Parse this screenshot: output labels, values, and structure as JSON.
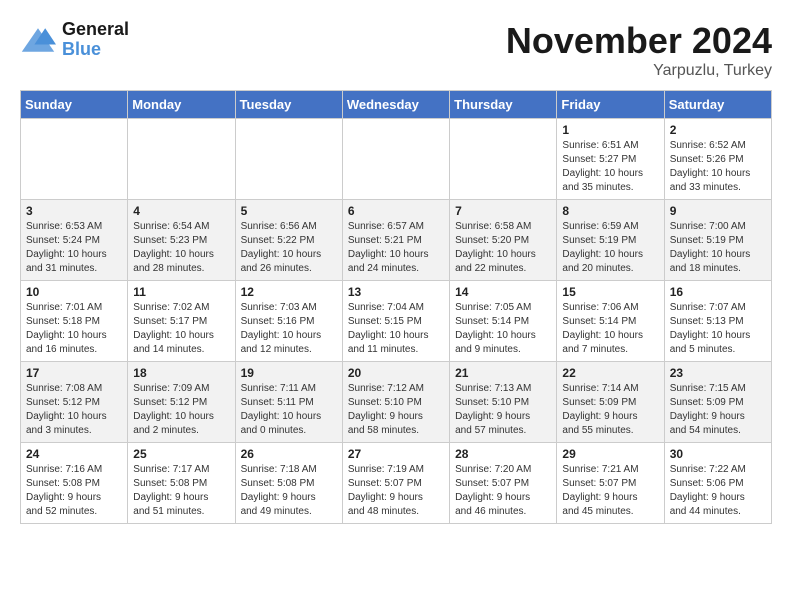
{
  "header": {
    "logo_line1": "General",
    "logo_line2": "Blue",
    "month": "November 2024",
    "location": "Yarpuzlu, Turkey"
  },
  "weekdays": [
    "Sunday",
    "Monday",
    "Tuesday",
    "Wednesday",
    "Thursday",
    "Friday",
    "Saturday"
  ],
  "weeks": [
    [
      {
        "day": "",
        "info": ""
      },
      {
        "day": "",
        "info": ""
      },
      {
        "day": "",
        "info": ""
      },
      {
        "day": "",
        "info": ""
      },
      {
        "day": "",
        "info": ""
      },
      {
        "day": "1",
        "info": "Sunrise: 6:51 AM\nSunset: 5:27 PM\nDaylight: 10 hours\nand 35 minutes."
      },
      {
        "day": "2",
        "info": "Sunrise: 6:52 AM\nSunset: 5:26 PM\nDaylight: 10 hours\nand 33 minutes."
      }
    ],
    [
      {
        "day": "3",
        "info": "Sunrise: 6:53 AM\nSunset: 5:24 PM\nDaylight: 10 hours\nand 31 minutes."
      },
      {
        "day": "4",
        "info": "Sunrise: 6:54 AM\nSunset: 5:23 PM\nDaylight: 10 hours\nand 28 minutes."
      },
      {
        "day": "5",
        "info": "Sunrise: 6:56 AM\nSunset: 5:22 PM\nDaylight: 10 hours\nand 26 minutes."
      },
      {
        "day": "6",
        "info": "Sunrise: 6:57 AM\nSunset: 5:21 PM\nDaylight: 10 hours\nand 24 minutes."
      },
      {
        "day": "7",
        "info": "Sunrise: 6:58 AM\nSunset: 5:20 PM\nDaylight: 10 hours\nand 22 minutes."
      },
      {
        "day": "8",
        "info": "Sunrise: 6:59 AM\nSunset: 5:19 PM\nDaylight: 10 hours\nand 20 minutes."
      },
      {
        "day": "9",
        "info": "Sunrise: 7:00 AM\nSunset: 5:19 PM\nDaylight: 10 hours\nand 18 minutes."
      }
    ],
    [
      {
        "day": "10",
        "info": "Sunrise: 7:01 AM\nSunset: 5:18 PM\nDaylight: 10 hours\nand 16 minutes."
      },
      {
        "day": "11",
        "info": "Sunrise: 7:02 AM\nSunset: 5:17 PM\nDaylight: 10 hours\nand 14 minutes."
      },
      {
        "day": "12",
        "info": "Sunrise: 7:03 AM\nSunset: 5:16 PM\nDaylight: 10 hours\nand 12 minutes."
      },
      {
        "day": "13",
        "info": "Sunrise: 7:04 AM\nSunset: 5:15 PM\nDaylight: 10 hours\nand 11 minutes."
      },
      {
        "day": "14",
        "info": "Sunrise: 7:05 AM\nSunset: 5:14 PM\nDaylight: 10 hours\nand 9 minutes."
      },
      {
        "day": "15",
        "info": "Sunrise: 7:06 AM\nSunset: 5:14 PM\nDaylight: 10 hours\nand 7 minutes."
      },
      {
        "day": "16",
        "info": "Sunrise: 7:07 AM\nSunset: 5:13 PM\nDaylight: 10 hours\nand 5 minutes."
      }
    ],
    [
      {
        "day": "17",
        "info": "Sunrise: 7:08 AM\nSunset: 5:12 PM\nDaylight: 10 hours\nand 3 minutes."
      },
      {
        "day": "18",
        "info": "Sunrise: 7:09 AM\nSunset: 5:12 PM\nDaylight: 10 hours\nand 2 minutes."
      },
      {
        "day": "19",
        "info": "Sunrise: 7:11 AM\nSunset: 5:11 PM\nDaylight: 10 hours\nand 0 minutes."
      },
      {
        "day": "20",
        "info": "Sunrise: 7:12 AM\nSunset: 5:10 PM\nDaylight: 9 hours\nand 58 minutes."
      },
      {
        "day": "21",
        "info": "Sunrise: 7:13 AM\nSunset: 5:10 PM\nDaylight: 9 hours\nand 57 minutes."
      },
      {
        "day": "22",
        "info": "Sunrise: 7:14 AM\nSunset: 5:09 PM\nDaylight: 9 hours\nand 55 minutes."
      },
      {
        "day": "23",
        "info": "Sunrise: 7:15 AM\nSunset: 5:09 PM\nDaylight: 9 hours\nand 54 minutes."
      }
    ],
    [
      {
        "day": "24",
        "info": "Sunrise: 7:16 AM\nSunset: 5:08 PM\nDaylight: 9 hours\nand 52 minutes."
      },
      {
        "day": "25",
        "info": "Sunrise: 7:17 AM\nSunset: 5:08 PM\nDaylight: 9 hours\nand 51 minutes."
      },
      {
        "day": "26",
        "info": "Sunrise: 7:18 AM\nSunset: 5:08 PM\nDaylight: 9 hours\nand 49 minutes."
      },
      {
        "day": "27",
        "info": "Sunrise: 7:19 AM\nSunset: 5:07 PM\nDaylight: 9 hours\nand 48 minutes."
      },
      {
        "day": "28",
        "info": "Sunrise: 7:20 AM\nSunset: 5:07 PM\nDaylight: 9 hours\nand 46 minutes."
      },
      {
        "day": "29",
        "info": "Sunrise: 7:21 AM\nSunset: 5:07 PM\nDaylight: 9 hours\nand 45 minutes."
      },
      {
        "day": "30",
        "info": "Sunrise: 7:22 AM\nSunset: 5:06 PM\nDaylight: 9 hours\nand 44 minutes."
      }
    ]
  ]
}
